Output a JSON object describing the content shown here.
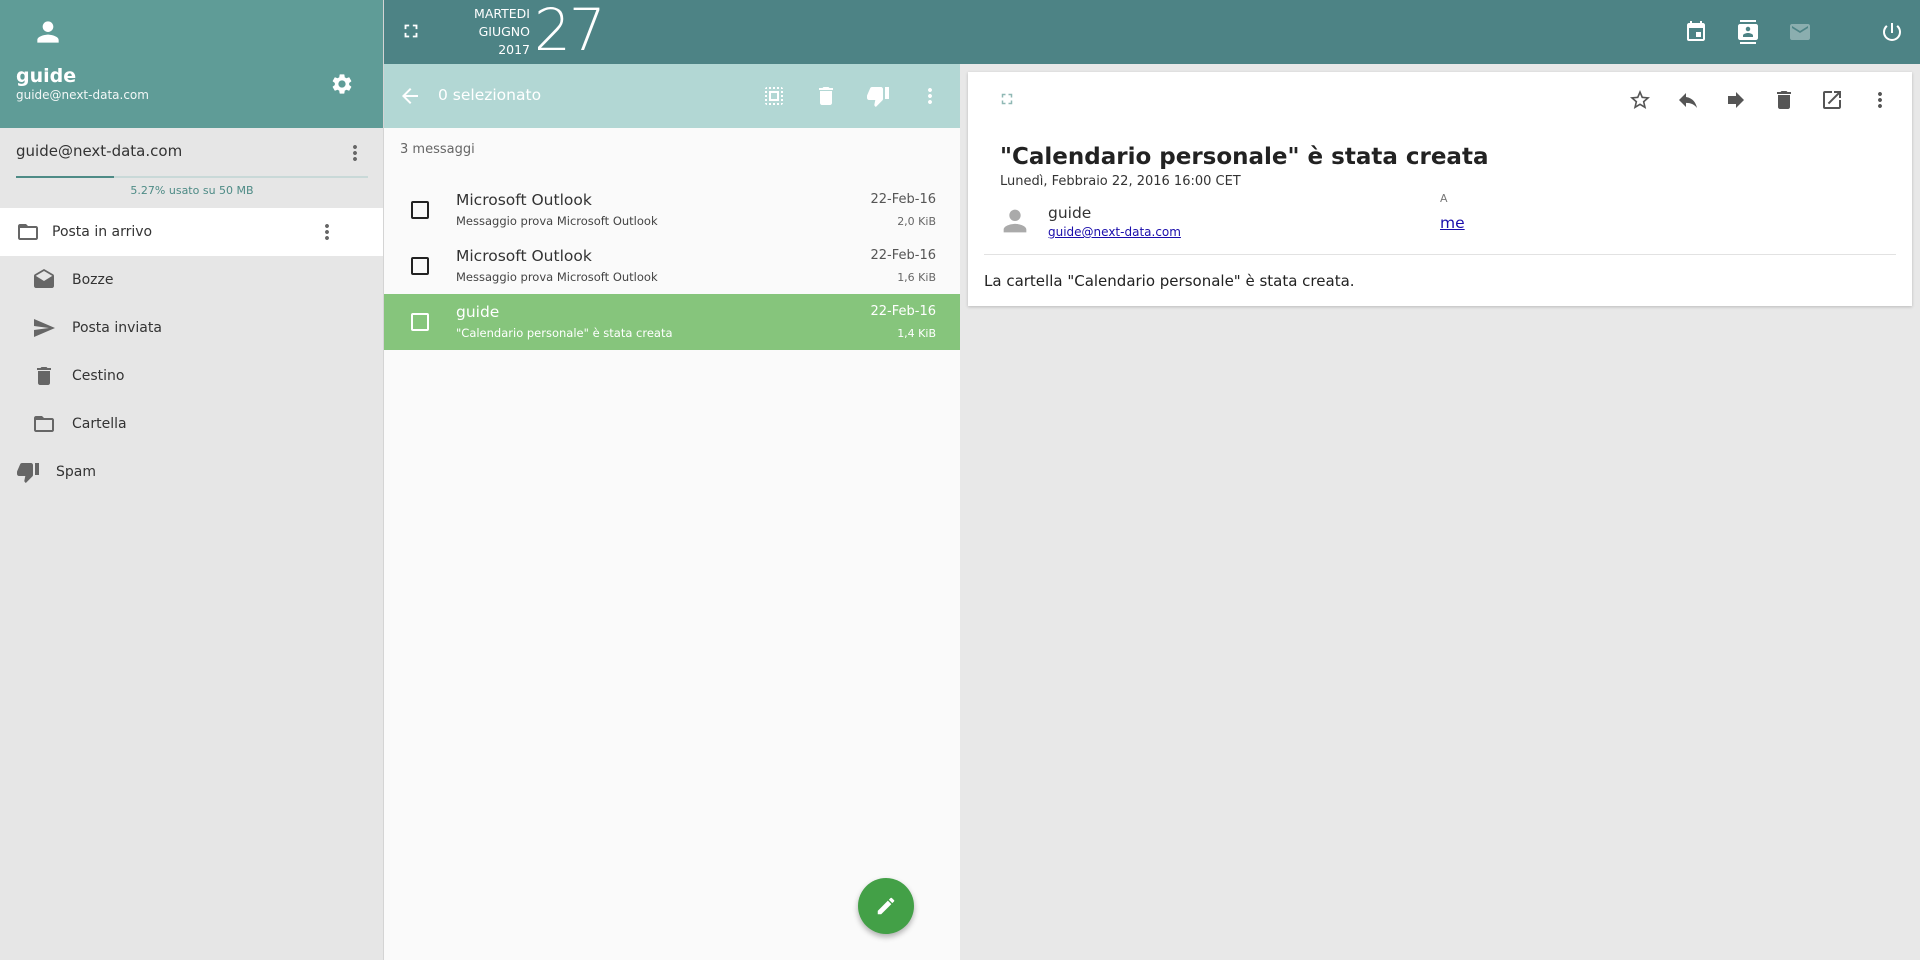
{
  "sidebar": {
    "user_name": "guide",
    "user_email": "guide@next-data.com",
    "account_email": "guide@next-data.com",
    "quota_text": "5.27% usato su 50 MB",
    "quota_fraction": 0.0527,
    "folders": {
      "inbox": "Posta in arrivo",
      "drafts": "Bozze",
      "sent": "Posta inviata",
      "trash": "Cestino",
      "folder": "Cartella",
      "spam": "Spam"
    }
  },
  "topbar": {
    "weekday": "MARTEDI",
    "month": "GIUGNO",
    "year": "2017",
    "day": "27"
  },
  "list": {
    "selection_text": "0 selezionato",
    "count_text": "3 messaggi",
    "rows": [
      {
        "from": "Microsoft Outlook",
        "subject": "Messaggio prova Microsoft Outlook",
        "date": "22-Feb-16",
        "size": "2,0 KiB"
      },
      {
        "from": "Microsoft Outlook",
        "subject": "Messaggio prova Microsoft Outlook",
        "date": "22-Feb-16",
        "size": "1,6 KiB"
      },
      {
        "from": "guide",
        "subject": "\"Calendario personale\" è stata creata",
        "date": "22-Feb-16",
        "size": "1,4 KiB",
        "selected": true
      }
    ]
  },
  "reader": {
    "subject": "\"Calendario personale\" è stata creata",
    "date": "Lunedì, Febbraio 22, 2016 16:00 CET",
    "from_name": "guide",
    "from_email": "guide@next-data.com",
    "to_label": "A",
    "to": "me",
    "body": "La cartella \"Calendario personale\" è stata creata."
  },
  "colors": {
    "sidebar_header": "#5f9c97",
    "topbar": "#4d8385",
    "list_toolbar": "#b2d7d4",
    "selected_row": "#86c57c",
    "fab": "#43a047"
  },
  "icons": {
    "avatar": "person-icon",
    "settings": "gear-icon",
    "more": "more-vert-icon",
    "inbox": "folder-icon",
    "drafts": "drafts-icon",
    "sent": "send-icon",
    "trash": "trash-icon",
    "folder": "folder-icon",
    "spam": "thumb-down-icon",
    "compose": "pencil-icon"
  }
}
